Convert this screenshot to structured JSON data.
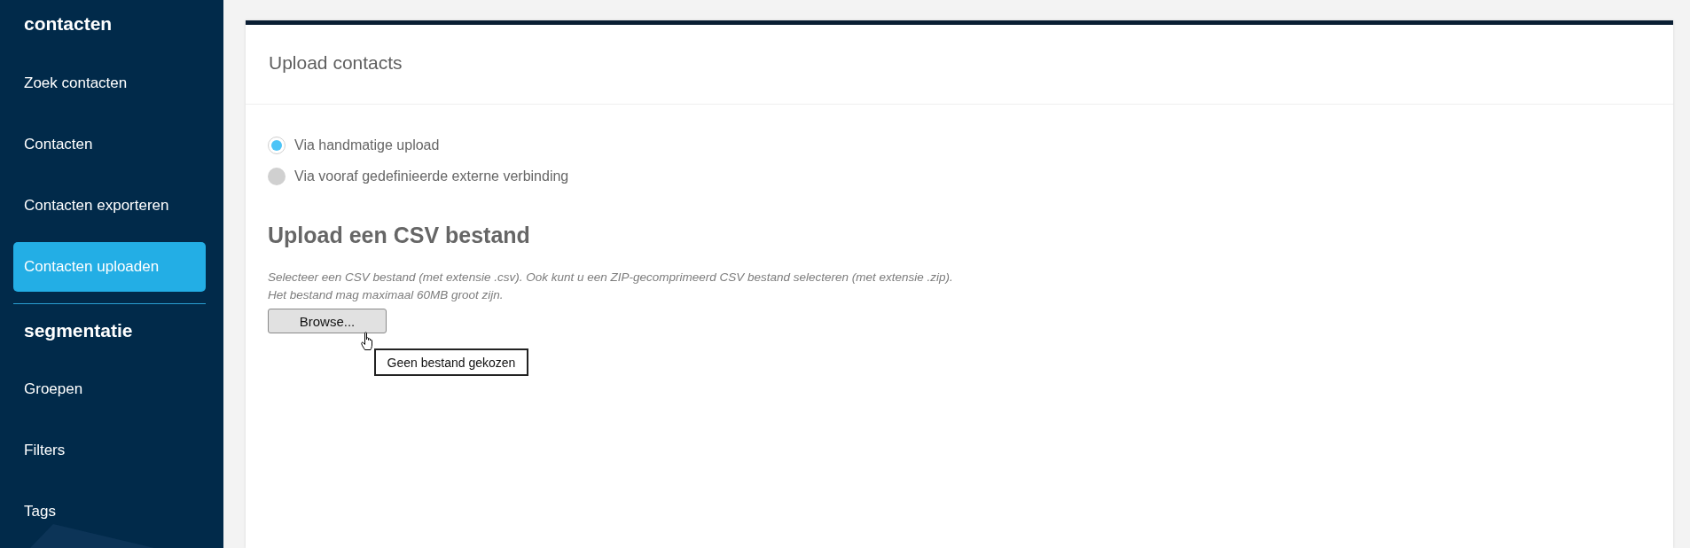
{
  "sidebar": {
    "sections": [
      {
        "title": "contacten",
        "items": [
          {
            "label": "Zoek contacten",
            "selected": false
          },
          {
            "label": "Contacten",
            "selected": false
          },
          {
            "label": "Contacten exporteren",
            "selected": false
          },
          {
            "label": "Contacten uploaden",
            "selected": true
          }
        ]
      },
      {
        "title": "segmentatie",
        "items": [
          {
            "label": "Groepen",
            "selected": false
          },
          {
            "label": "Filters",
            "selected": false
          },
          {
            "label": "Tags",
            "selected": false
          }
        ]
      }
    ]
  },
  "card": {
    "title": "Upload contacts",
    "options": [
      {
        "label": "Via handmatige upload",
        "selected": true
      },
      {
        "label": "Via vooraf gedefinieerde externe verbinding",
        "selected": false
      }
    ],
    "upload": {
      "heading": "Upload een CSV bestand",
      "description": [
        "Selecteer een CSV bestand (met extensie .csv). Ook kunt u een ZIP-gecomprimeerd CSV bestand selecteren (met extensie .zip).",
        "Het bestand mag maximaal 60MB groot zijn."
      ],
      "button": "Browse...",
      "tooltip": "Geen bestand gekozen"
    }
  }
}
